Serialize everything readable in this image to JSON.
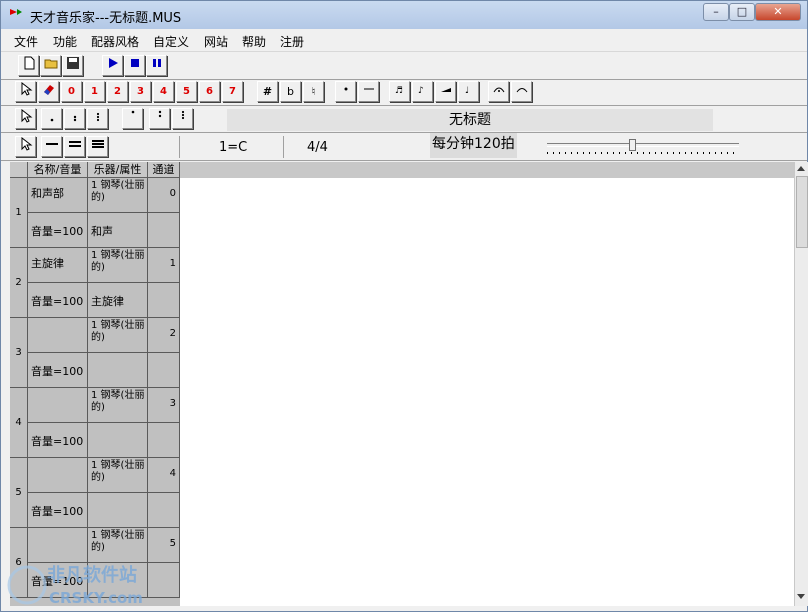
{
  "window": {
    "title": "天才音乐家---无标题.MUS",
    "app_icon_text": "精灵"
  },
  "menu": [
    "文件",
    "功能",
    "配器风格",
    "自定义",
    "网站",
    "帮助",
    "注册"
  ],
  "toolbar2": {
    "digits": [
      "0",
      "1",
      "2",
      "3",
      "4",
      "5",
      "6",
      "7"
    ],
    "accidentals": [
      "#",
      "b",
      "♮"
    ]
  },
  "score": {
    "title": "无标题",
    "key": "1=C",
    "time_sig": "4/4",
    "tempo": "每分钟120拍"
  },
  "grid": {
    "headers": [
      "名称/音量",
      "乐器/属性",
      "通道"
    ],
    "tracks": [
      {
        "num": "1",
        "name": "和声部",
        "instrument": "1 钢琴(壮丽的)",
        "channel": "0",
        "volume": "音量=100",
        "attr": "和声"
      },
      {
        "num": "2",
        "name": "主旋律",
        "instrument": "1 钢琴(壮丽的)",
        "channel": "1",
        "volume": "音量=100",
        "attr": "主旋律"
      },
      {
        "num": "3",
        "name": "",
        "instrument": "1 钢琴(壮丽的)",
        "channel": "2",
        "volume": "音量=100",
        "attr": ""
      },
      {
        "num": "4",
        "name": "",
        "instrument": "1 钢琴(壮丽的)",
        "channel": "3",
        "volume": "音量=100",
        "attr": ""
      },
      {
        "num": "5",
        "name": "",
        "instrument": "1 钢琴(壮丽的)",
        "channel": "4",
        "volume": "音量=100",
        "attr": ""
      },
      {
        "num": "6",
        "name": "",
        "instrument": "1 钢琴(壮丽的)",
        "channel": "5",
        "volume": "音量=100",
        "attr": ""
      }
    ]
  },
  "watermark": {
    "line1": "非凡软件站",
    "line2": "CRSKY.com"
  },
  "colors": {
    "titlebar": "#c3d5ee",
    "grid_bg": "#c0c0c0",
    "canvas": "#ffffff",
    "digit_red": "#dd0000"
  }
}
